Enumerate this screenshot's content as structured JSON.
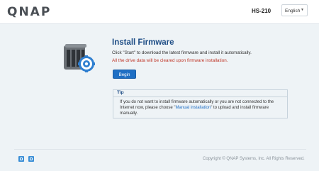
{
  "header": {
    "logo_text": "QNAP",
    "model": "HS-210",
    "language": "English"
  },
  "main": {
    "title": "Install Firmware",
    "description": "Click \"Start\" to download the latest firmware and install it automatically.",
    "warning": "All the drive data will be cleared upon firmware installation.",
    "begin_label": "Begin"
  },
  "tip": {
    "label": "Tip",
    "text_before": "If you do not want to install firmware automatically or you are not connected to the Internet now, please choose \"",
    "link_text": "Manual installation",
    "text_after": "\" to upload and install firmware manually."
  },
  "footer": {
    "copyright": "Copyright © QNAP Systems, Inc. All Rights Reserved.",
    "icons": [
      "app-icon",
      "app-icon"
    ]
  },
  "colors": {
    "accent": "#1f6fc4",
    "title": "#1f4e86",
    "warning": "#c0392b",
    "background": "#eef3f6"
  }
}
